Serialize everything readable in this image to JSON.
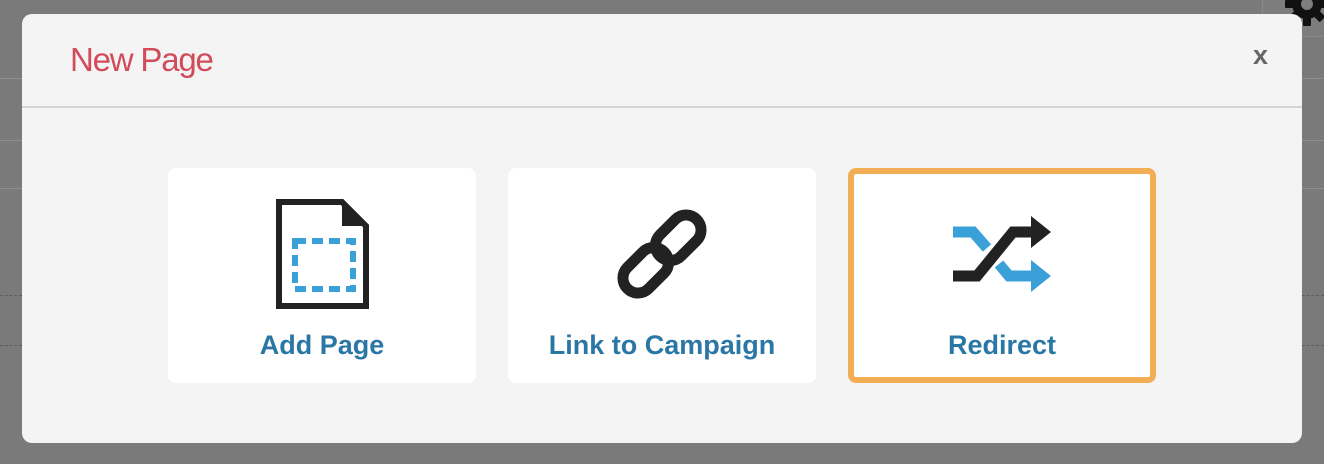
{
  "modal": {
    "title": "New Page",
    "close_label": "x"
  },
  "options": [
    {
      "label": "Add Page",
      "icon": "add-page-icon",
      "selected": false
    },
    {
      "label": "Link to Campaign",
      "icon": "link-icon",
      "selected": false
    },
    {
      "label": "Redirect",
      "icon": "shuffle-redirect-icon",
      "selected": true
    }
  ],
  "colors": {
    "title": "#d14b5a",
    "label": "#2a77a6",
    "selected_border": "#f2ae54",
    "icon_blue": "#3aa0d8",
    "icon_dark": "#222222"
  }
}
